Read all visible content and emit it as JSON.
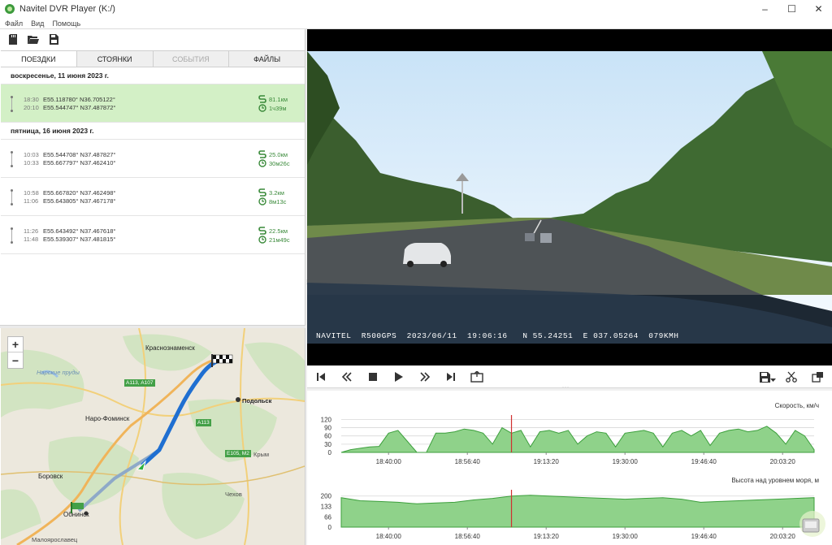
{
  "window": {
    "title": "Navitel DVR Player (K:/)",
    "controls": [
      "–",
      "☐",
      "✕"
    ]
  },
  "menu": [
    "Файл",
    "Вид",
    "Помощь"
  ],
  "toolbar": {
    "icons": [
      "sd-card-icon",
      "folder-open-icon",
      "save-file-icon"
    ]
  },
  "tabs": [
    {
      "label": "ПОЕЗДКИ",
      "state": "active"
    },
    {
      "label": "СТОЯНКИ",
      "state": "normal"
    },
    {
      "label": "СОБЫТИЯ",
      "state": "disabled"
    },
    {
      "label": "ФАЙЛЫ",
      "state": "normal"
    }
  ],
  "trips": {
    "day1": {
      "date": "воскресенье, 11 июня 2023 г.",
      "items": [
        {
          "t1": "18:30",
          "c1": "E55.118780° N36.705122°",
          "t2": "20:10",
          "c2": "E55.544747° N37.487872°",
          "distance": "81.1км",
          "duration": "1ч39м",
          "selected": true
        }
      ]
    },
    "day2": {
      "date": "пятница, 16 июня 2023 г.",
      "items": [
        {
          "t1": "10:03",
          "c1": "E55.544708° N37.487827°",
          "t2": "10:33",
          "c2": "E55.667797° N37.462410°",
          "distance": "25.0км",
          "duration": "30м26с"
        },
        {
          "t1": "10:58",
          "c1": "E55.667820° N37.462498°",
          "t2": "11:06",
          "c2": "E55.643805° N37.467178°",
          "distance": "3.2км",
          "duration": "8м13с"
        },
        {
          "t1": "11:26",
          "c1": "E55.643492° N37.467618°",
          "t2": "11:48",
          "c2": "E55.539307° N37.481815°",
          "distance": "22.5км",
          "duration": "21м49с"
        }
      ]
    }
  },
  "map": {
    "zoom_in": "+",
    "zoom_out": "−",
    "labels": {
      "krasnoznamensk": "Краснознаменск",
      "narskie": "Нарские пруды",
      "naro": "Наро-Фоминск",
      "podolsk": "Подольск",
      "borovsk": "Боровск",
      "obninsk": "Обнинск",
      "maloyaroslavets": "Малоярославец",
      "chekhov": "Чехов",
      "krym": "Крым"
    },
    "shields": {
      "a113a107": "А113, А107",
      "a113": "А113",
      "e105m2": "Е105, М2"
    }
  },
  "video": {
    "osd_brand": "NAVITEL  R500GPS  2023/06/11  19:06:16",
    "osd_gps": "N 55.24251  E 037.05264  079KMH"
  },
  "charts": {
    "speed": {
      "title": "Скорость, км/ч",
      "yticks": [
        "120",
        "90",
        "60",
        "30",
        "0"
      ],
      "xticks": [
        "18:40:00",
        "18:56:40",
        "19:13:20",
        "19:30:00",
        "19:46:40",
        "20:03:20"
      ]
    },
    "altitude": {
      "title": "Высота над уровнем моря, м",
      "yticks": [
        "200",
        "133",
        "66",
        "0"
      ],
      "xticks": [
        "18:40:00",
        "18:56:40",
        "19:13:20",
        "19:30:00",
        "19:46:40",
        "20:03:20"
      ]
    }
  },
  "chart_data": [
    {
      "type": "area",
      "title": "Скорость, км/ч",
      "ylim": [
        0,
        130
      ],
      "x_ticks": [
        "18:40:00",
        "18:56:40",
        "19:13:20",
        "19:30:00",
        "19:46:40",
        "20:03:20"
      ],
      "x": [
        "18:30",
        "18:32",
        "18:34",
        "18:36",
        "18:38",
        "18:40",
        "18:42",
        "18:44",
        "18:46",
        "18:48",
        "18:50",
        "18:52",
        "18:54",
        "18:56",
        "18:58",
        "19:00",
        "19:02",
        "19:04",
        "19:06",
        "19:08",
        "19:10",
        "19:12",
        "19:14",
        "19:16",
        "19:18",
        "19:20",
        "19:22",
        "19:24",
        "19:26",
        "19:28",
        "19:30",
        "19:32",
        "19:34",
        "19:36",
        "19:38",
        "19:40",
        "19:42",
        "19:44",
        "19:46",
        "19:48",
        "19:50",
        "19:52",
        "19:54",
        "19:56",
        "19:58",
        "20:00",
        "20:02",
        "20:04",
        "20:06",
        "20:08",
        "20:10"
      ],
      "series": [
        {
          "values": [
            0,
            10,
            15,
            20,
            22,
            70,
            80,
            40,
            0,
            0,
            70,
            70,
            75,
            85,
            80,
            70,
            30,
            90,
            70,
            80,
            20,
            75,
            80,
            70,
            80,
            30,
            60,
            75,
            70,
            20,
            70,
            75,
            80,
            70,
            20,
            70,
            80,
            60,
            80,
            25,
            70,
            80,
            85,
            75,
            80,
            95,
            70,
            30,
            80,
            60,
            10
          ]
        }
      ],
      "cursor_x": "19:06"
    },
    {
      "type": "area",
      "title": "Высота над уровнем моря, м",
      "ylim": [
        0,
        230
      ],
      "x_ticks": [
        "18:40:00",
        "18:56:40",
        "19:13:20",
        "19:30:00",
        "19:46:40",
        "20:03:20"
      ],
      "x": [
        "18:30",
        "18:34",
        "18:38",
        "18:42",
        "18:46",
        "18:50",
        "18:54",
        "18:58",
        "19:02",
        "19:06",
        "19:10",
        "19:14",
        "19:18",
        "19:22",
        "19:26",
        "19:30",
        "19:34",
        "19:38",
        "19:42",
        "19:46",
        "19:50",
        "19:54",
        "19:58",
        "20:02",
        "20:06",
        "20:10"
      ],
      "series": [
        {
          "values": [
            190,
            170,
            165,
            160,
            150,
            155,
            160,
            175,
            185,
            200,
            205,
            200,
            195,
            190,
            185,
            180,
            185,
            190,
            180,
            160,
            165,
            170,
            175,
            180,
            185,
            190
          ]
        }
      ],
      "cursor_x": "19:06"
    }
  ]
}
